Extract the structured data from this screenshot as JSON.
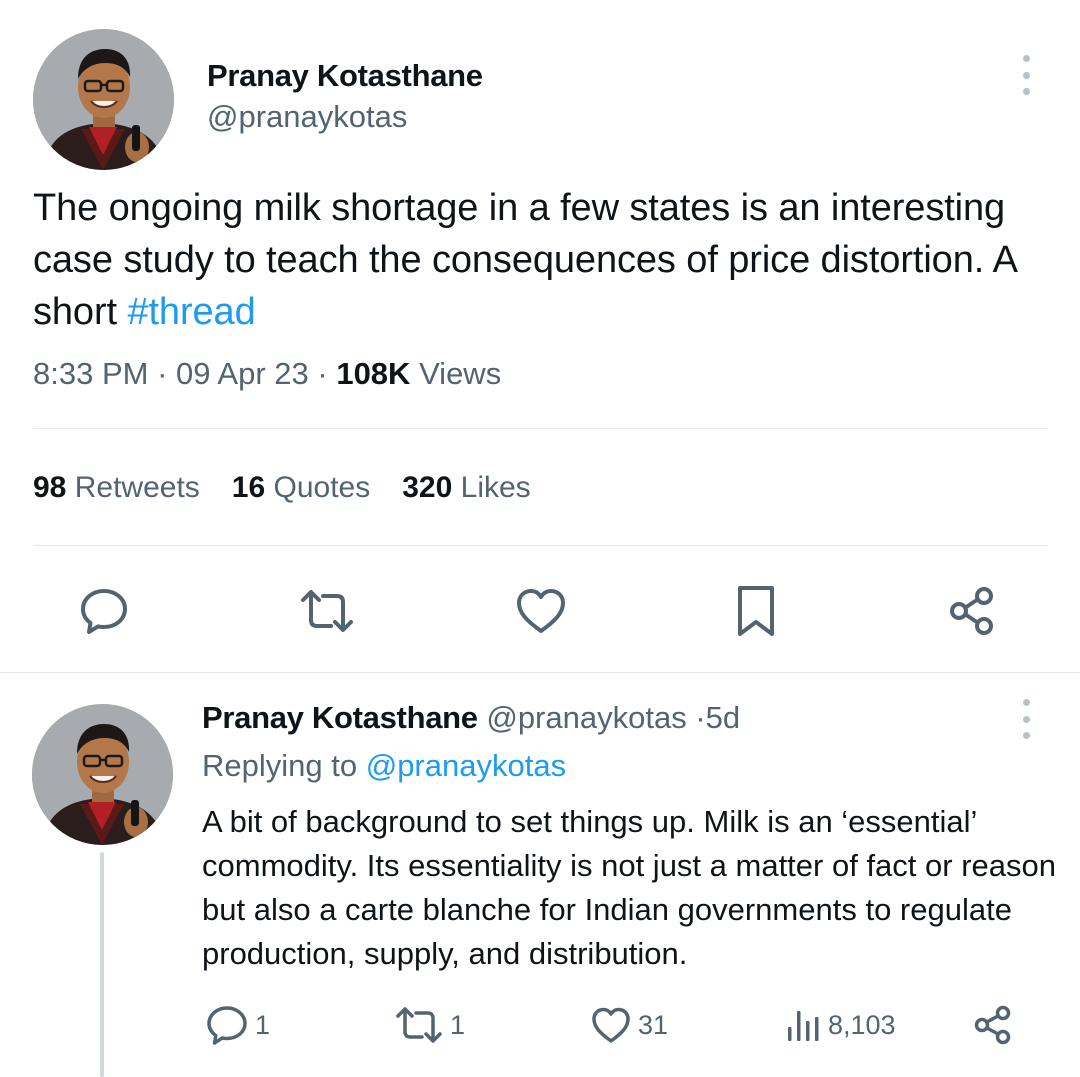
{
  "main_tweet": {
    "author_name": "Pranay Kotasthane",
    "author_handle": "@pranaykotas",
    "text_before_hashtag": "The ongoing milk shortage in a few states is an interesting case study to teach the consequences of price distortion. A short ",
    "hashtag": "#thread",
    "time": "8:33 PM",
    "date": "09 Apr 23",
    "views_count": "108K",
    "views_label": "Views",
    "separator": "·",
    "stats": {
      "retweets_count": "98",
      "retweets_label": "Retweets",
      "quotes_count": "16",
      "quotes_label": "Quotes",
      "likes_count": "320",
      "likes_label": "Likes"
    },
    "actions": [
      "reply-icon",
      "retweet-icon",
      "like-icon",
      "bookmark-icon",
      "share-icon"
    ]
  },
  "reply_tweet": {
    "author_name": "Pranay Kotasthane",
    "author_handle": "@pranaykotas",
    "separator": "·",
    "age": "5d",
    "replying_to_label": "Replying to",
    "replying_to_handle": "@pranaykotas",
    "text": "A bit of background to set things up. Milk is an ‘essential’ commodity. Its essentiality is not just a matter of fact or reason but also a carte blanche for Indian governments to regulate production, supply, and distribution.",
    "actions": {
      "replies": "1",
      "retweets": "1",
      "likes": "31",
      "views": "8,103"
    }
  },
  "colors": {
    "text_primary": "#0f1419",
    "text_secondary": "#536471",
    "link": "#1d9bf0",
    "divider": "#e6e9ec",
    "thread_line": "#cfd9de"
  }
}
